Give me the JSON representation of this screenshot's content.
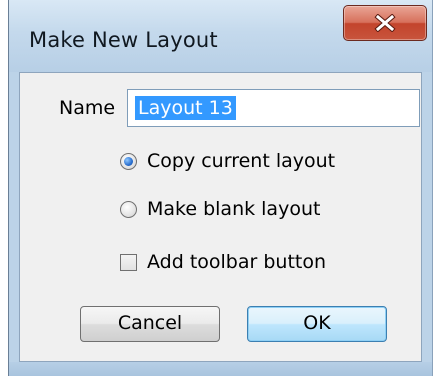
{
  "dialog": {
    "title": "Make New Layout",
    "close_icon": "close-x-icon"
  },
  "form": {
    "name_label": "Name",
    "name_value": "Layout 13",
    "options": [
      {
        "label": "Copy current layout",
        "checked": true
      },
      {
        "label": "Make blank layout",
        "checked": false
      }
    ],
    "toolbar_checkbox": {
      "label": "Add toolbar button",
      "checked": false
    }
  },
  "buttons": {
    "cancel_label": "Cancel",
    "ok_label": "OK"
  },
  "colors": {
    "close_button": "#c8553d",
    "selection": "#3399ff",
    "window_frame": "#bcd3e8"
  }
}
